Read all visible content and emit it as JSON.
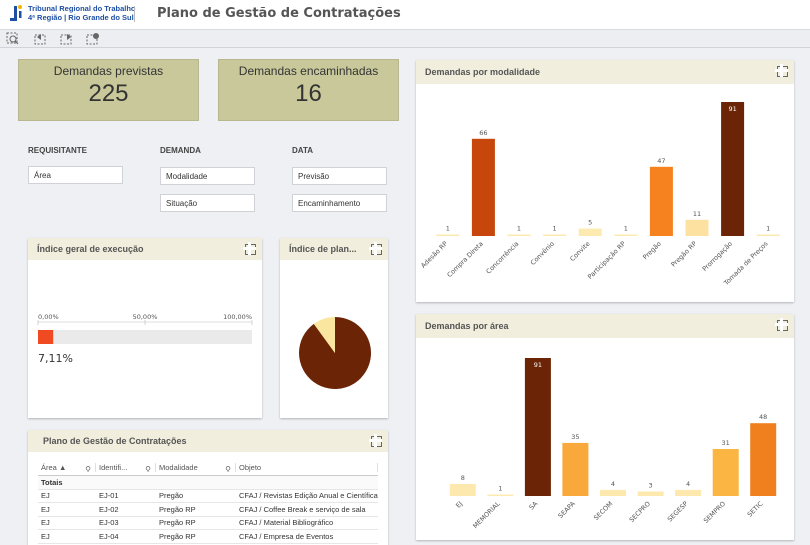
{
  "header": {
    "org_line1": "Tribunal Regional do Trabalho",
    "org_line2": "4ª Região | Rio Grande do Sul",
    "title": "Plano de Gestão de Contratações"
  },
  "toolbar": {
    "icons": [
      "search-selection-icon",
      "step-back-icon",
      "step-forward-icon",
      "clear-selection-icon"
    ]
  },
  "kpis": [
    {
      "label": "Demandas previstas",
      "value": "225"
    },
    {
      "label": "Demandas encaminhadas",
      "value": "16"
    }
  ],
  "filters": {
    "requisitante": {
      "label": "REQUISITANTE",
      "items": [
        "Área"
      ]
    },
    "demanda": {
      "label": "DEMANDA",
      "items": [
        "Modalidade",
        "Situação"
      ]
    },
    "data": {
      "label": "DATA",
      "items": [
        "Previsão",
        "Encaminhamento"
      ]
    }
  },
  "gauge": {
    "title": "Índice geral de execução",
    "tick_min": "0,00%",
    "tick_mid": "50,00%",
    "tick_max": "100,00%",
    "value_label": "7,11%",
    "value": 0.0711,
    "fill_color": "#f04a22"
  },
  "pie_card": {
    "title": "Índice de plan...",
    "slices": [
      {
        "value": 0.9,
        "color": "#6b2506"
      },
      {
        "value": 0.1,
        "color": "#fbe6a0"
      }
    ]
  },
  "table": {
    "title": "Plano de Gestão de Contratações",
    "columns": [
      "Área",
      "Identifi...",
      "Modalidade",
      "Objeto"
    ],
    "totals_label": "Totais",
    "rows": [
      [
        "EJ",
        "EJ-01",
        "Pregão",
        "CFAJ / Revistas Edição Anual e Científica"
      ],
      [
        "EJ",
        "EJ-02",
        "Pregão RP",
        "CFAJ / Coffee Break e serviço de sala"
      ],
      [
        "EJ",
        "EJ-03",
        "Pregão RP",
        "CFAJ / Material Bibliográfico"
      ],
      [
        "EJ",
        "EJ-04",
        "Pregão RP",
        "CFAJ / Empresa de Eventos"
      ]
    ]
  },
  "chart_data": [
    {
      "type": "bar",
      "title": "Demandas por modalidade",
      "categories": [
        "Adesão RP",
        "Compra Direta",
        "Concorrência",
        "Convênio",
        "Convite",
        "Participação RP",
        "Pregão",
        "Pregão RP",
        "Prorrogação",
        "Tomada de Preços"
      ],
      "values": [
        1,
        66,
        1,
        1,
        5,
        1,
        47,
        11,
        91,
        1
      ],
      "colors": [
        "#fdeab0",
        "#c7460c",
        "#fdeab0",
        "#fdeab0",
        "#fdeab0",
        "#fdeab0",
        "#f5811f",
        "#fde1a0",
        "#6b2506",
        "#fdeab0"
      ],
      "ylim": [
        0,
        91
      ]
    },
    {
      "type": "bar",
      "title": "Demandas por área",
      "categories": [
        "EJ",
        "MEMORIAL",
        "SA",
        "SEAPA",
        "SECOM",
        "SECPRO",
        "SEGESP",
        "SEMPRO",
        "SETIC"
      ],
      "values": [
        8,
        1,
        91,
        35,
        4,
        3,
        4,
        31,
        48
      ],
      "colors": [
        "#fde9ae",
        "#fdeab0",
        "#6b2506",
        "#f9a83c",
        "#fde9ae",
        "#fde9ae",
        "#fde9ae",
        "#fbb543",
        "#f0801e"
      ],
      "ylim": [
        0,
        91
      ]
    }
  ]
}
